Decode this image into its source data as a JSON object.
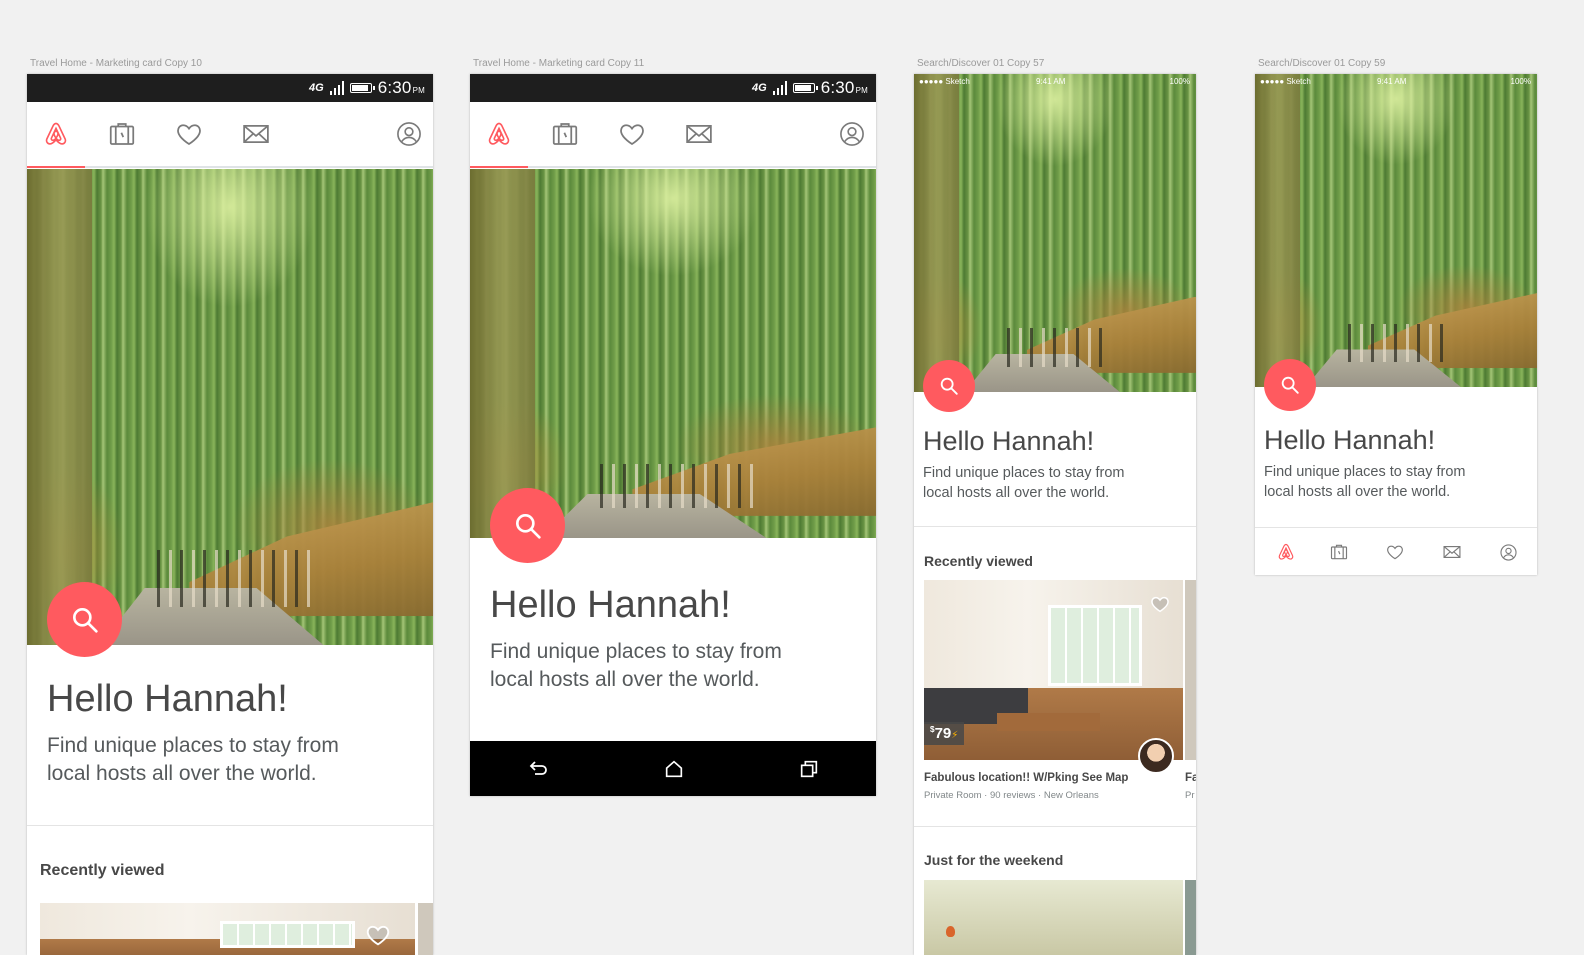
{
  "artboards": [
    {
      "label": "Travel Home - Marketing card Copy 10"
    },
    {
      "label": "Travel Home - Marketing card Copy 11"
    },
    {
      "label": "Search/Discover 01 Copy 57"
    },
    {
      "label": "Search/Discover 01 Copy 59"
    }
  ],
  "android_status": {
    "network": "4G",
    "time": "6:30",
    "meridiem": "PM"
  },
  "ios_status": {
    "carrier": "●●●●● Sketch",
    "time": "9:41 AM",
    "battery": "100%"
  },
  "hero": {
    "greeting": "Hello Hannah!",
    "subline_1": "Find unique places to stay from",
    "subline_2": "local hosts all over the world."
  },
  "sections": {
    "recently_viewed": "Recently viewed",
    "weekend": "Just for the weekend"
  },
  "listing": {
    "price": "79",
    "title": "Fabulous location!! W/Pking See Map",
    "meta": "Private Room · 90 reviews · New Orleans"
  },
  "peek": {
    "price": "$",
    "title": "Fa",
    "meta": "Pr"
  },
  "colors": {
    "accent": "#ff5a5f",
    "text": "#484848",
    "background": "#f1f1f1"
  },
  "icons": [
    "airbnb-logo-icon",
    "trips-icon",
    "heart-icon",
    "messages-icon",
    "profile-icon",
    "search-icon",
    "back-icon",
    "home-icon",
    "recents-icon"
  ]
}
